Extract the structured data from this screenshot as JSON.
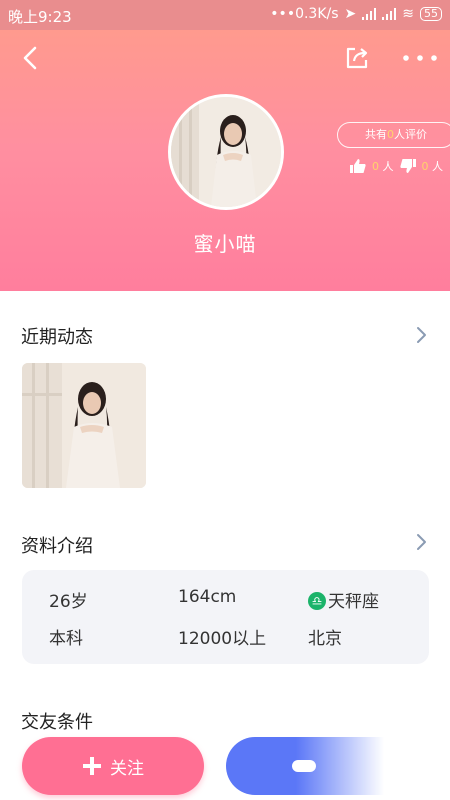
{
  "status_bar": {
    "time": "晚上9:23",
    "speed": "•••0.3K/s",
    "battery": "55"
  },
  "profile": {
    "name": "蜜小喵",
    "rating_prefix": "共有",
    "rating_count": "0",
    "rating_suffix": "人评价",
    "likes": "0",
    "dislikes": "0",
    "unit": "人"
  },
  "sections": {
    "recent": "近期动态",
    "info": "资料介绍",
    "conditions": "交友条件"
  },
  "info": {
    "age": "26岁",
    "height": "164cm",
    "zodiac": "天秤座",
    "zodiac_symbol": "♎",
    "education": "本科",
    "income": "12000以上",
    "city": "北京"
  },
  "actions": {
    "follow": "关注"
  },
  "colors": {
    "accent_pink": "#ff6f93",
    "accent_blue": "#5b77f7",
    "zodiac_green": "#1bb36a"
  }
}
